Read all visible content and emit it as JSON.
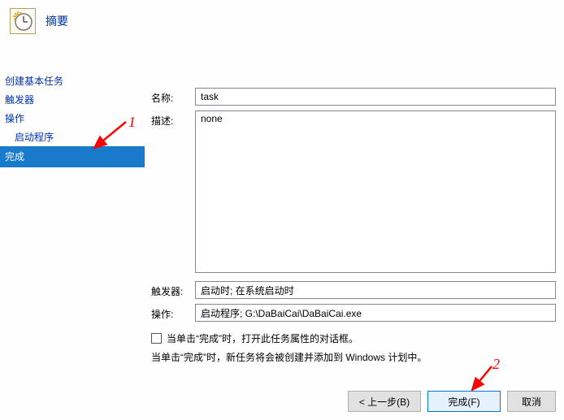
{
  "header": {
    "title": "摘要"
  },
  "sidebar": {
    "items": [
      {
        "label": "创建基本任务"
      },
      {
        "label": "触发器"
      },
      {
        "label": "操作"
      },
      {
        "label": "启动程序"
      },
      {
        "label": "完成"
      }
    ]
  },
  "form": {
    "name_label": "名称:",
    "name_value": "task",
    "desc_label": "描述:",
    "desc_value": "none",
    "trigger_label": "触发器:",
    "trigger_value": "启动时; 在系统启动时",
    "action_label": "操作:",
    "action_value": "启动程序; G:\\DaBaiCai\\DaBaiCai.exe",
    "checkbox_label": "当单击“完成”时，打开此任务属性的对话框。",
    "info_text": "当单击“完成”时，新任务将会被创建并添加到 Windows 计划中。"
  },
  "buttons": {
    "back": "< 上一步(B)",
    "finish": "完成(F)",
    "cancel": "取消"
  },
  "annotations": {
    "one": "1",
    "two": "2"
  }
}
